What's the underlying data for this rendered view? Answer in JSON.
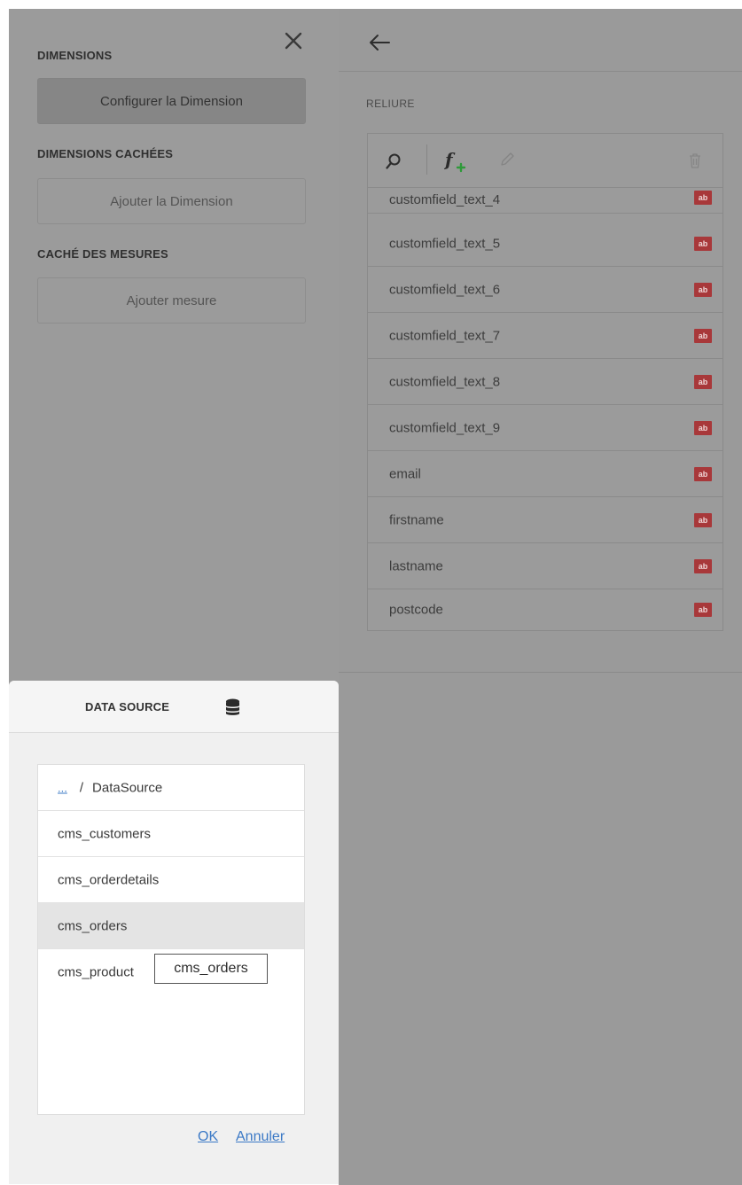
{
  "left_panel": {
    "dimensions_title": "DIMENSIONS",
    "configure_dimension_label": "Configurer la Dimension",
    "hidden_dimensions_title": "DIMENSIONS CACHÉES",
    "add_dimension_label": "Ajouter la Dimension",
    "hidden_measures_title": "CACHÉ DES MESURES",
    "add_measure_label": "Ajouter mesure"
  },
  "right_panel": {
    "binding_label": "RELIURE",
    "fields": [
      {
        "name": "customfield_text_4",
        "type_badge": "ab"
      },
      {
        "name": "customfield_text_5",
        "type_badge": "ab"
      },
      {
        "name": "customfield_text_6",
        "type_badge": "ab"
      },
      {
        "name": "customfield_text_7",
        "type_badge": "ab"
      },
      {
        "name": "customfield_text_8",
        "type_badge": "ab"
      },
      {
        "name": "customfield_text_9",
        "type_badge": "ab"
      },
      {
        "name": "email",
        "type_badge": "ab"
      },
      {
        "name": "firstname",
        "type_badge": "ab"
      },
      {
        "name": "lastname",
        "type_badge": "ab"
      },
      {
        "name": "postcode",
        "type_badge": "ab"
      }
    ]
  },
  "data_source_dialog": {
    "title": "DATA SOURCE",
    "breadcrumb_parent": "...",
    "breadcrumb_separator": "/",
    "breadcrumb_current": "DataSource",
    "items": [
      {
        "label": "cms_customers"
      },
      {
        "label": "cms_orderdetails"
      },
      {
        "label": "cms_orders"
      },
      {
        "label": "cms_product"
      }
    ],
    "selected_index": 2,
    "tooltip_text": "cms_orders",
    "ok_label": "OK",
    "cancel_label": "Annuler"
  },
  "icons": {
    "close": "close-icon",
    "back": "arrow-left-icon",
    "search": "search-icon",
    "add_function": "add-function-icon",
    "edit": "pencil-icon",
    "delete": "trash-icon",
    "database": "database-icon"
  },
  "colors": {
    "badge": "#a8383a",
    "link": "#3b79c6",
    "add_function_plus": "#2f9a3a"
  }
}
